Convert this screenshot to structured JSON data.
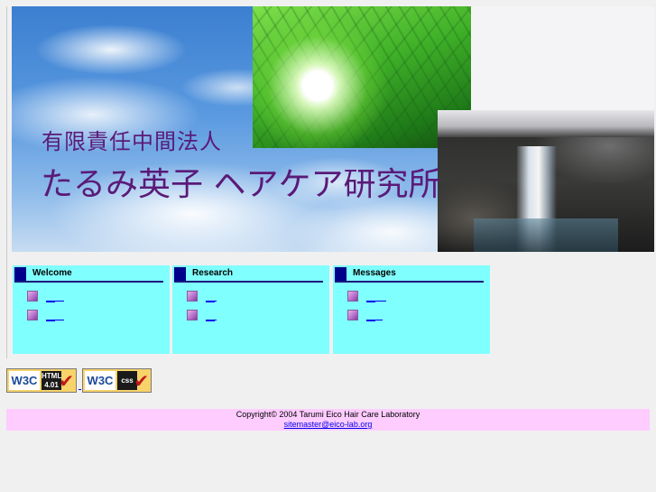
{
  "banner": {
    "subtitle": "有限責任中間法人",
    "title": "たるみ英子 ヘアケア研究所"
  },
  "nav": [
    {
      "heading": "Welcome",
      "items": [
        "　",
        "　"
      ]
    },
    {
      "heading": "Research",
      "items": [
        "　",
        "　"
      ]
    },
    {
      "heading": "Messages",
      "items": [
        "　",
        "　"
      ]
    }
  ],
  "badges": {
    "w3c_label": "W3C",
    "html_label": "HTML 4.01",
    "css_label": "css",
    "check_symbol": "✔"
  },
  "footer": {
    "copyright": "Copyright© 2004 Tarumi Eico Hair Care Laboratory",
    "email": "sitemaster@eico-lab.org"
  },
  "colors": {
    "title_purple": "#5a1a78",
    "nav_bg": "#80ffff",
    "nav_header_square": "#00008b",
    "footer_bg": "#ffccff",
    "link_blue": "#0000ee"
  }
}
